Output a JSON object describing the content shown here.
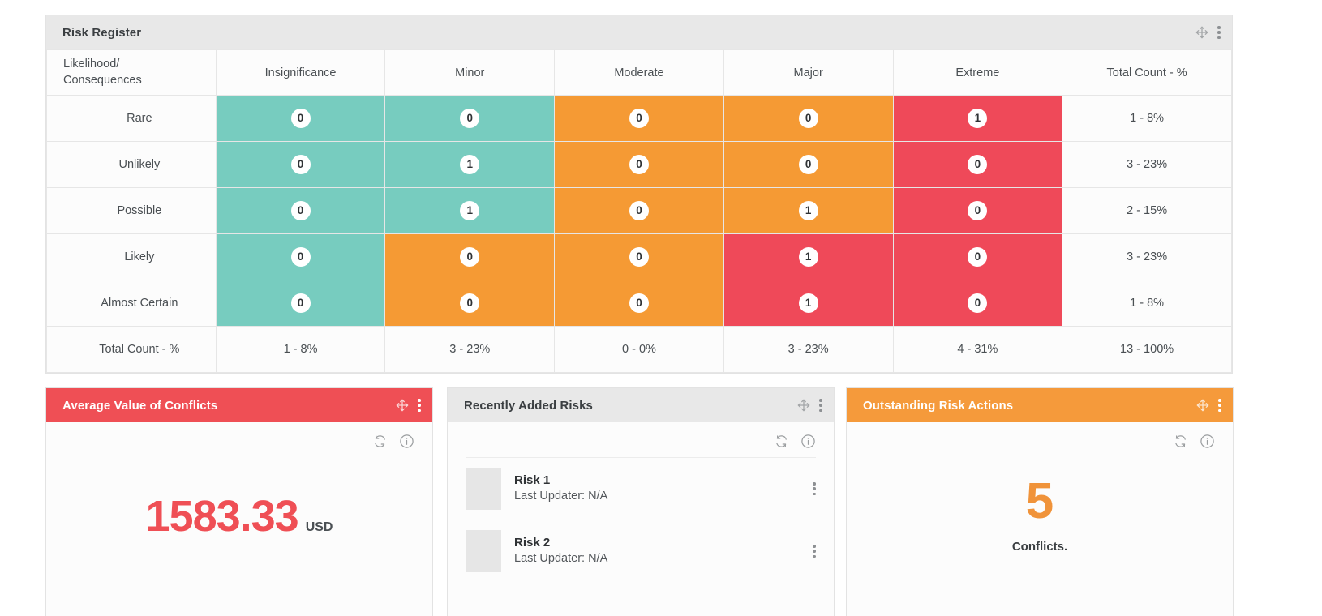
{
  "risk_register": {
    "title": "Risk Register",
    "tools": {
      "move_icon": "move-icon",
      "menu_icon": "kebab-menu-icon"
    },
    "corner_header": "Likelihood/\nConsequences",
    "corner_header_line1": "Likelihood/",
    "corner_header_line2": "Consequences",
    "columns": [
      "Insignificance",
      "Minor",
      "Moderate",
      "Major",
      "Extreme",
      "Total Count - %"
    ],
    "rows": [
      {
        "label": "Rare",
        "values": [
          "0",
          "0",
          "0",
          "0",
          "1"
        ],
        "colors": [
          "green",
          "green",
          "orange",
          "orange",
          "red"
        ],
        "total": "1 - 8%"
      },
      {
        "label": "Unlikely",
        "values": [
          "0",
          "1",
          "0",
          "0",
          "0"
        ],
        "colors": [
          "green",
          "green",
          "orange",
          "orange",
          "red"
        ],
        "total": "3 - 23%"
      },
      {
        "label": "Possible",
        "values": [
          "0",
          "1",
          "0",
          "1",
          "0"
        ],
        "colors": [
          "green",
          "green",
          "orange",
          "orange",
          "red"
        ],
        "total": "2 - 15%"
      },
      {
        "label": "Likely",
        "values": [
          "0",
          "0",
          "0",
          "1",
          "0"
        ],
        "colors": [
          "green",
          "orange",
          "orange",
          "red",
          "red"
        ],
        "total": "3 - 23%"
      },
      {
        "label": "Almost Certain",
        "values": [
          "0",
          "0",
          "0",
          "1",
          "0"
        ],
        "colors": [
          "green",
          "orange",
          "orange",
          "red",
          "red"
        ],
        "total": "1 - 8%"
      }
    ],
    "footer": {
      "label": "Total Count - %",
      "values": [
        "1 - 8%",
        "3 - 23%",
        "0 - 0%",
        "3 - 23%",
        "4 - 31%"
      ],
      "grand_total": "13 - 100%"
    },
    "palette": {
      "green": "#77ccbf",
      "orange": "#f59a34",
      "red": "#ef4959"
    }
  },
  "average_value": {
    "title": "Average Value of Conflicts",
    "header_color": "#ef4f55",
    "value": "1583.33",
    "unit": "USD",
    "tools": {
      "refresh_icon": "refresh-icon",
      "info_icon": "info-icon",
      "move_icon": "move-icon",
      "menu_icon": "kebab-menu-icon"
    }
  },
  "recently_added": {
    "title": "Recently Added Risks",
    "tools": {
      "refresh_icon": "refresh-icon",
      "info_icon": "info-icon",
      "move_icon": "move-icon",
      "menu_icon": "kebab-menu-icon"
    },
    "items": [
      {
        "name": "Risk 1",
        "subtitle": "Last Updater: N/A"
      },
      {
        "name": "Risk 2",
        "subtitle": "Last Updater: N/A"
      }
    ]
  },
  "outstanding_actions": {
    "title": "Outstanding Risk Actions",
    "header_color": "#f59a3b",
    "count": "5",
    "caption": "Conflicts.",
    "tools": {
      "refresh_icon": "refresh-icon",
      "info_icon": "info-icon",
      "move_icon": "move-icon",
      "menu_icon": "kebab-menu-icon"
    }
  }
}
